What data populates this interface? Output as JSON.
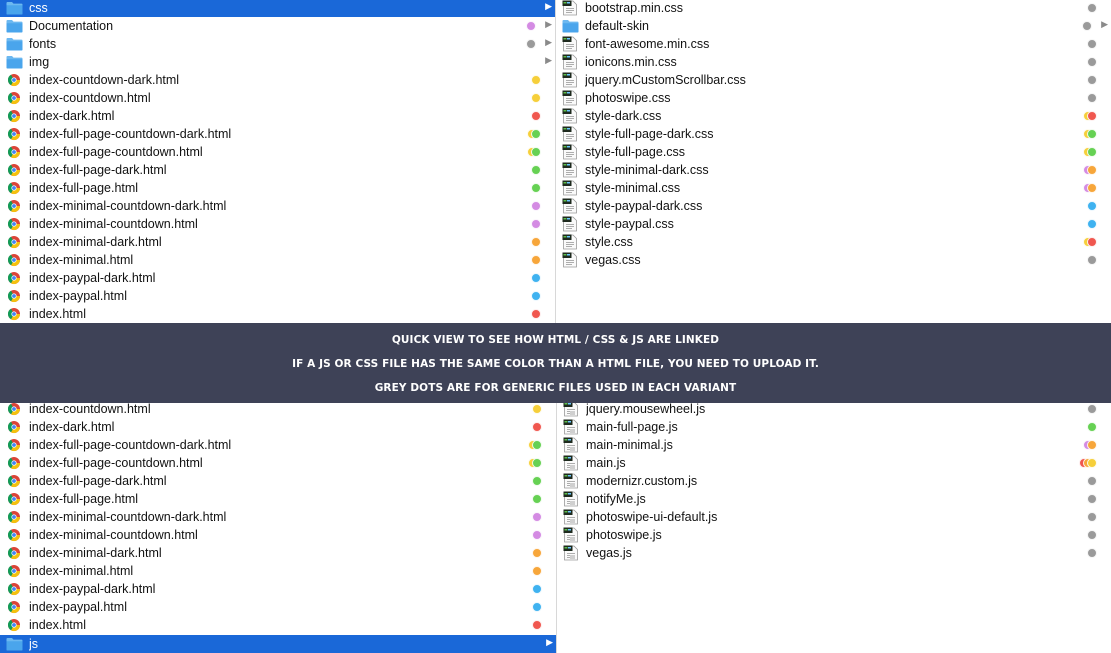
{
  "colors": {
    "grey": "#9a9a9a",
    "purple": "#d48be3",
    "yellow": "#f6cf3a",
    "red": "#f0574f",
    "green": "#66d153",
    "orange": "#f7a63a",
    "blue": "#3fb2f0",
    "selected": "#1a68d8",
    "banner": "#3e4257"
  },
  "top_left": {
    "rows": [
      {
        "label": "css",
        "icon": "folder-icon",
        "tags": [],
        "chevron": true,
        "selected": true
      },
      {
        "label": "Documentation",
        "icon": "folder-icon",
        "tags": [
          "purple"
        ],
        "chevron": true
      },
      {
        "label": "fonts",
        "icon": "folder-icon",
        "tags": [
          "grey"
        ],
        "chevron": true
      },
      {
        "label": "img",
        "icon": "folder-icon",
        "tags": [],
        "chevron": true
      },
      {
        "label": "index-countdown-dark.html",
        "icon": "html-file-icon",
        "tags": [
          "yellow"
        ]
      },
      {
        "label": "index-countdown.html",
        "icon": "html-file-icon",
        "tags": [
          "yellow"
        ]
      },
      {
        "label": "index-dark.html",
        "icon": "html-file-icon",
        "tags": [
          "red"
        ]
      },
      {
        "label": "index-full-page-countdown-dark.html",
        "icon": "html-file-icon",
        "tags": [
          "yellow",
          "green"
        ]
      },
      {
        "label": "index-full-page-countdown.html",
        "icon": "html-file-icon",
        "tags": [
          "yellow",
          "green"
        ]
      },
      {
        "label": "index-full-page-dark.html",
        "icon": "html-file-icon",
        "tags": [
          "green"
        ]
      },
      {
        "label": "index-full-page.html",
        "icon": "html-file-icon",
        "tags": [
          "green"
        ]
      },
      {
        "label": "index-minimal-countdown-dark.html",
        "icon": "html-file-icon",
        "tags": [
          "purple"
        ]
      },
      {
        "label": "index-minimal-countdown.html",
        "icon": "html-file-icon",
        "tags": [
          "purple"
        ]
      },
      {
        "label": "index-minimal-dark.html",
        "icon": "html-file-icon",
        "tags": [
          "orange"
        ]
      },
      {
        "label": "index-minimal.html",
        "icon": "html-file-icon",
        "tags": [
          "orange"
        ]
      },
      {
        "label": "index-paypal-dark.html",
        "icon": "html-file-icon",
        "tags": [
          "blue"
        ]
      },
      {
        "label": "index-paypal.html",
        "icon": "html-file-icon",
        "tags": [
          "blue"
        ]
      },
      {
        "label": "index.html",
        "icon": "html-file-icon",
        "tags": [
          "red"
        ]
      }
    ]
  },
  "top_right": {
    "rows": [
      {
        "label": "bootstrap.min.css",
        "icon": "css-file-icon",
        "tags": [
          "grey"
        ]
      },
      {
        "label": "default-skin",
        "icon": "folder-icon",
        "tags": [
          "grey"
        ],
        "chevron": true
      },
      {
        "label": "font-awesome.min.css",
        "icon": "css-file-icon",
        "tags": [
          "grey"
        ]
      },
      {
        "label": "ionicons.min.css",
        "icon": "css-file-icon",
        "tags": [
          "grey"
        ]
      },
      {
        "label": "jquery.mCustomScrollbar.css",
        "icon": "css-file-icon",
        "tags": [
          "grey"
        ]
      },
      {
        "label": "photoswipe.css",
        "icon": "css-file-icon",
        "tags": [
          "grey"
        ]
      },
      {
        "label": "style-dark.css",
        "icon": "css-file-icon",
        "tags": [
          "yellow",
          "red"
        ]
      },
      {
        "label": "style-full-page-dark.css",
        "icon": "css-file-icon",
        "tags": [
          "yellow",
          "green"
        ]
      },
      {
        "label": "style-full-page.css",
        "icon": "css-file-icon",
        "tags": [
          "yellow",
          "green"
        ]
      },
      {
        "label": "style-minimal-dark.css",
        "icon": "css-file-icon",
        "tags": [
          "purple",
          "orange"
        ]
      },
      {
        "label": "style-minimal.css",
        "icon": "css-file-icon",
        "tags": [
          "purple",
          "orange"
        ]
      },
      {
        "label": "style-paypal-dark.css",
        "icon": "css-file-icon",
        "tags": [
          "blue"
        ]
      },
      {
        "label": "style-paypal.css",
        "icon": "css-file-icon",
        "tags": [
          "blue"
        ]
      },
      {
        "label": "style.css",
        "icon": "css-file-icon",
        "tags": [
          "yellow",
          "red"
        ]
      },
      {
        "label": "vegas.css",
        "icon": "css-file-icon",
        "tags": [
          "grey"
        ]
      }
    ]
  },
  "banner": {
    "line1": "QUICK VIEW TO SEE HOW HTML / CSS & JS ARE LINKED",
    "line2": "IF A JS OR CSS FILE HAS THE SAME COLOR THAN A HTML FILE, YOU NEED TO UPLOAD IT.",
    "line3": "GREY DOTS ARE FOR GENERIC FILES USED IN EACH VARIANT"
  },
  "bottom_left": {
    "rows": [
      {
        "label": "index-countdown.html",
        "icon": "html-file-icon",
        "tags": [
          "yellow"
        ]
      },
      {
        "label": "index-dark.html",
        "icon": "html-file-icon",
        "tags": [
          "red"
        ]
      },
      {
        "label": "index-full-page-countdown-dark.html",
        "icon": "html-file-icon",
        "tags": [
          "yellow",
          "green"
        ]
      },
      {
        "label": "index-full-page-countdown.html",
        "icon": "html-file-icon",
        "tags": [
          "yellow",
          "green"
        ]
      },
      {
        "label": "index-full-page-dark.html",
        "icon": "html-file-icon",
        "tags": [
          "green"
        ]
      },
      {
        "label": "index-full-page.html",
        "icon": "html-file-icon",
        "tags": [
          "green"
        ]
      },
      {
        "label": "index-minimal-countdown-dark.html",
        "icon": "html-file-icon",
        "tags": [
          "purple"
        ]
      },
      {
        "label": "index-minimal-countdown.html",
        "icon": "html-file-icon",
        "tags": [
          "purple"
        ]
      },
      {
        "label": "index-minimal-dark.html",
        "icon": "html-file-icon",
        "tags": [
          "orange"
        ]
      },
      {
        "label": "index-minimal.html",
        "icon": "html-file-icon",
        "tags": [
          "orange"
        ]
      },
      {
        "label": "index-paypal-dark.html",
        "icon": "html-file-icon",
        "tags": [
          "blue"
        ]
      },
      {
        "label": "index-paypal.html",
        "icon": "html-file-icon",
        "tags": [
          "blue"
        ]
      },
      {
        "label": "index.html",
        "icon": "html-file-icon",
        "tags": [
          "red"
        ]
      },
      {
        "label": "js",
        "icon": "folder-icon",
        "tags": [],
        "chevron": true,
        "selected": true
      }
    ]
  },
  "bottom_right": {
    "rows": [
      {
        "label": "jquery.mousewheel.js",
        "icon": "js-file-icon",
        "tags": [
          "grey"
        ]
      },
      {
        "label": "main-full-page.js",
        "icon": "js-file-icon",
        "tags": [
          "green"
        ]
      },
      {
        "label": "main-minimal.js",
        "icon": "js-file-icon",
        "tags": [
          "purple",
          "orange"
        ]
      },
      {
        "label": "main.js",
        "icon": "js-file-icon",
        "tags": [
          "red",
          "orange",
          "yellow"
        ]
      },
      {
        "label": "modernizr.custom.js",
        "icon": "js-file-icon",
        "tags": [
          "grey"
        ]
      },
      {
        "label": "notifyMe.js",
        "icon": "js-file-icon",
        "tags": [
          "grey"
        ]
      },
      {
        "label": "photoswipe-ui-default.js",
        "icon": "js-file-icon",
        "tags": [
          "grey"
        ]
      },
      {
        "label": "photoswipe.js",
        "icon": "js-file-icon",
        "tags": [
          "grey"
        ]
      },
      {
        "label": "vegas.js",
        "icon": "js-file-icon",
        "tags": [
          "grey"
        ]
      }
    ]
  }
}
